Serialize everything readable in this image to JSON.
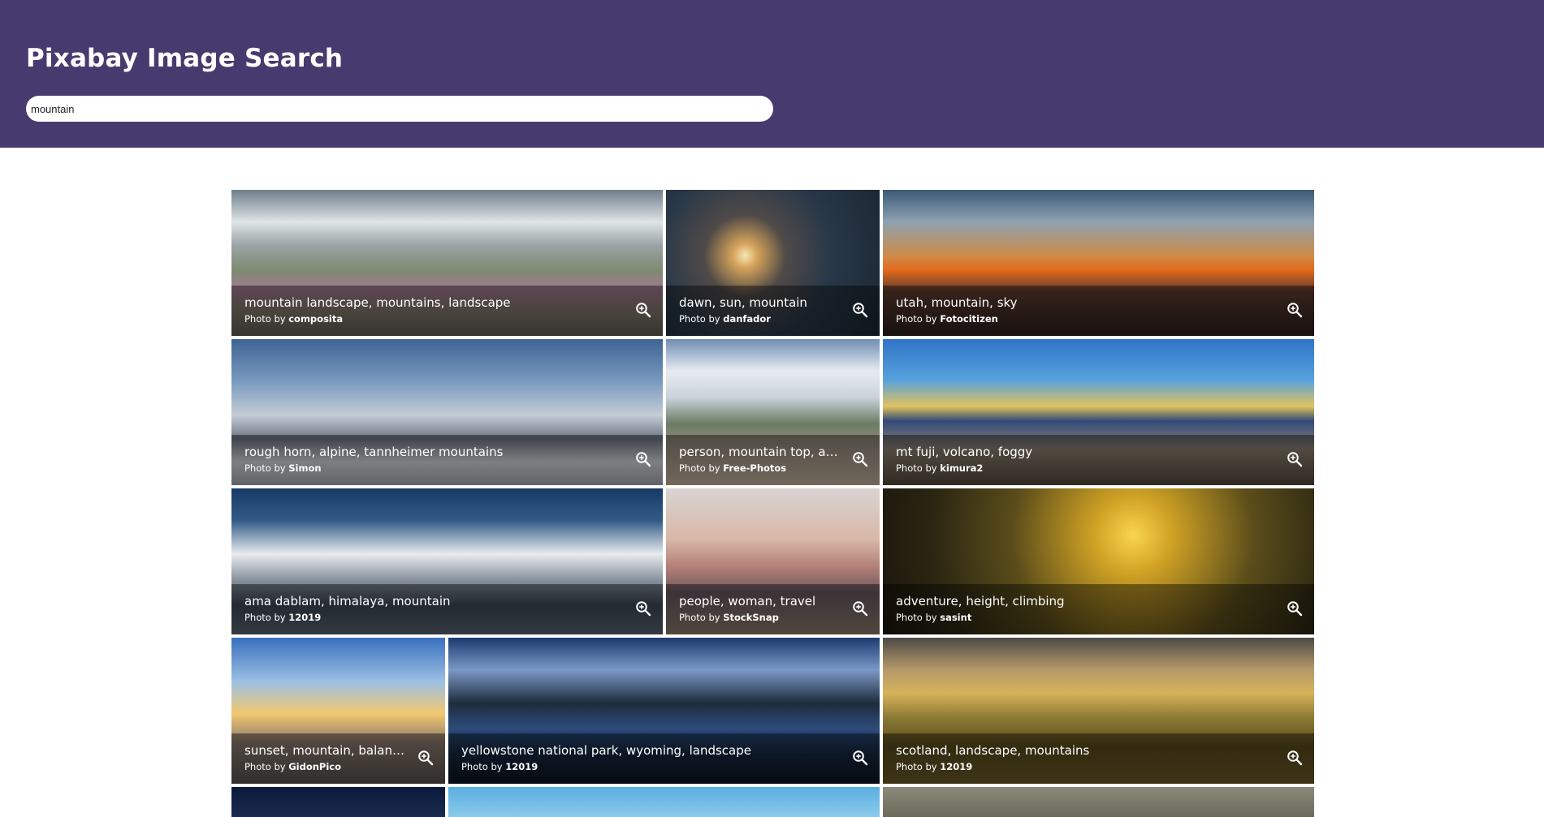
{
  "header": {
    "title": "Pixabay Image Search",
    "background_color": "#463a6e"
  },
  "search": {
    "value": "mountain",
    "placeholder": ""
  },
  "results": [
    {
      "title": "mountain landscape, mountains, landscape",
      "credit_prefix": "Photo by",
      "author": "composita"
    },
    {
      "title": "dawn, sun, mountain",
      "credit_prefix": "Photo by",
      "author": "danfador"
    },
    {
      "title": "utah, mountain, sky",
      "credit_prefix": "Photo by",
      "author": "Fotocitizen"
    },
    {
      "title": "rough horn, alpine, tannheimer mountains",
      "credit_prefix": "Photo by",
      "author": "Simon"
    },
    {
      "title": "person, mountain top, ach...",
      "credit_prefix": "Photo by",
      "author": "Free-Photos"
    },
    {
      "title": "mt fuji, volcano, foggy",
      "credit_prefix": "Photo by",
      "author": "kimura2"
    },
    {
      "title": "ama dablam, himalaya, mountain",
      "credit_prefix": "Photo by",
      "author": "12019"
    },
    {
      "title": "people, woman, travel",
      "credit_prefix": "Photo by",
      "author": "StockSnap"
    },
    {
      "title": "adventure, height, climbing",
      "credit_prefix": "Photo by",
      "author": "sasint"
    },
    {
      "title": "sunset, mountain, balance",
      "credit_prefix": "Photo by",
      "author": "GidonPico"
    },
    {
      "title": "yellowstone national park, wyoming, landscape",
      "credit_prefix": "Photo by",
      "author": "12019"
    },
    {
      "title": "scotland, landscape, mountains",
      "credit_prefix": "Photo by",
      "author": "12019"
    }
  ],
  "icons": {
    "zoom": "zoom-in-icon"
  }
}
